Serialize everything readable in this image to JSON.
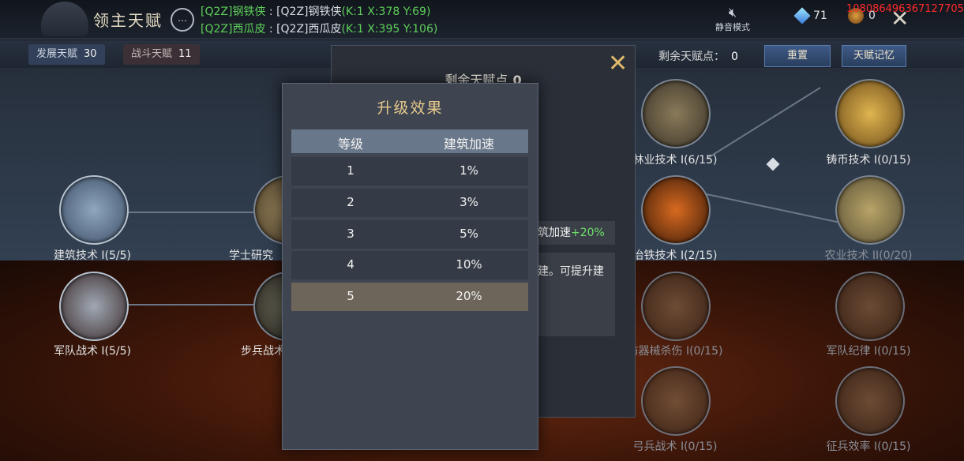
{
  "header": {
    "title": "领主天赋",
    "chat": [
      {
        "sender": "[Q2Z]钢铁侠",
        "sep": " : ",
        "message": "[Q2Z]钢铁侠",
        "coords": "(K:1 X:378 Y:69)"
      },
      {
        "sender": "[Q2Z]西瓜皮",
        "sep": " : ",
        "message": "[Q2Z]西瓜皮",
        "coords": "(K:1 X:395 Y:106)"
      }
    ],
    "mute_label": "静音模式",
    "mute_icon": "speaker-muted-icon",
    "gem_count": "71",
    "medal_count": "0",
    "debug_id": "108086496367127705",
    "close_icon": "close-x-icon"
  },
  "tabs": {
    "development_label": "发展天赋",
    "development_count": "30",
    "combat_label": "战斗天赋",
    "combat_count": "11"
  },
  "toolbar": {
    "remaining_label": "剩余天赋点：",
    "remaining_value": "0",
    "reset_label": "重置",
    "memory_label": "天赋记忆"
  },
  "tree": {
    "nodes": [
      {
        "label": "建筑技术 I(5/5)",
        "dim": false
      },
      {
        "label": "学士研究",
        "dim": false
      },
      {
        "label": "林业技术 I(6/15)",
        "dim": false
      },
      {
        "label": "铸币技术 I(0/15)",
        "dim": false
      },
      {
        "label": "冶铁技术 I(2/15)",
        "dim": false
      },
      {
        "label": "农业技术 II(0/20)",
        "dim": true
      },
      {
        "label": "军队战术 I(5/5)",
        "dim": false
      },
      {
        "label": "步兵战术",
        "dim": false
      },
      {
        "label": "防器械杀伤 I(0/15)",
        "dim": true
      },
      {
        "label": "军队纪律 I(0/15)",
        "dim": true
      },
      {
        "label": "弓兵战术 I(0/15)",
        "dim": true
      },
      {
        "label": "征兵效率 I(0/15)",
        "dim": true
      }
    ]
  },
  "detail": {
    "remaining_label": "剩余天赋点",
    "remaining_value": "0",
    "effect_label": "筑加速",
    "effect_value": "+20%",
    "description": "建。可提升建"
  },
  "upgrade_popup": {
    "title": "升级效果",
    "columns": [
      "等级",
      "建筑加速"
    ],
    "rows": [
      {
        "level": "1",
        "value": "1%",
        "selected": false
      },
      {
        "level": "2",
        "value": "3%",
        "selected": false
      },
      {
        "level": "3",
        "value": "5%",
        "selected": false
      },
      {
        "level": "4",
        "value": "10%",
        "selected": false
      },
      {
        "level": "5",
        "value": "20%",
        "selected": true
      }
    ]
  },
  "colors": {
    "accent_gold": "#e8c98c",
    "green_text": "#5fcf5a",
    "selected_row": "#6d655a",
    "header_row": "#69778a",
    "debug_red": "#ff2a2a"
  }
}
